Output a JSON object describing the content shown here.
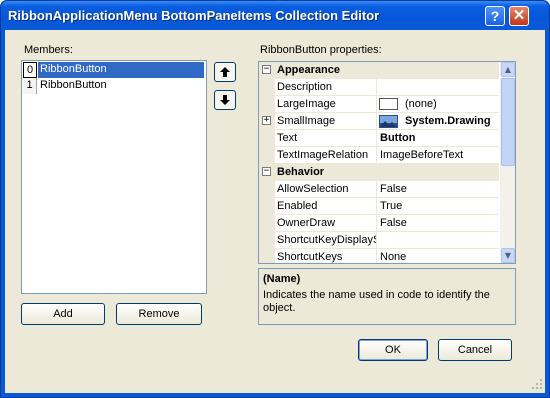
{
  "window": {
    "title": "RibbonApplicationMenu BottomPaneItems Collection Editor",
    "help_label": "?",
    "close_label": "✕"
  },
  "members": {
    "label": "Members:",
    "items": [
      {
        "index": "0",
        "name": "RibbonButton",
        "selected": true
      },
      {
        "index": "1",
        "name": "RibbonButton",
        "selected": false
      }
    ],
    "move_up_label": "🡅",
    "move_down_label": "🡇",
    "add_label": "Add",
    "remove_label": "Remove"
  },
  "properties": {
    "label": "RibbonButton properties:",
    "categories": [
      {
        "name": "Appearance",
        "rows": [
          {
            "name": "Description",
            "value": ""
          },
          {
            "name": "LargeImage",
            "value": "(none)"
          },
          {
            "name": "SmallImage",
            "value": "System.Drawing"
          },
          {
            "name": "Text",
            "value": "Button"
          },
          {
            "name": "TextImageRelation",
            "value": "ImageBeforeText"
          }
        ]
      },
      {
        "name": "Behavior",
        "rows": [
          {
            "name": "AllowSelection",
            "value": "False"
          },
          {
            "name": "Enabled",
            "value": "True"
          },
          {
            "name": "OwnerDraw",
            "value": "False"
          },
          {
            "name": "ShortcutKeyDisplayString",
            "value": ""
          },
          {
            "name": "ShortcutKeys",
            "value": "None"
          }
        ]
      }
    ],
    "expand_glyph": "⊟",
    "collapse_glyph": "⊞",
    "scroll_up": "▲",
    "scroll_down": "▼",
    "description": {
      "title": "(Name)",
      "text": "Indicates the name used in code to identify the object."
    }
  },
  "footer": {
    "ok_label": "OK",
    "cancel_label": "Cancel"
  },
  "colors": {
    "title_blue": "#0a5ad6",
    "selection": "#316ac5",
    "dialog_face": "#ece9d8"
  }
}
